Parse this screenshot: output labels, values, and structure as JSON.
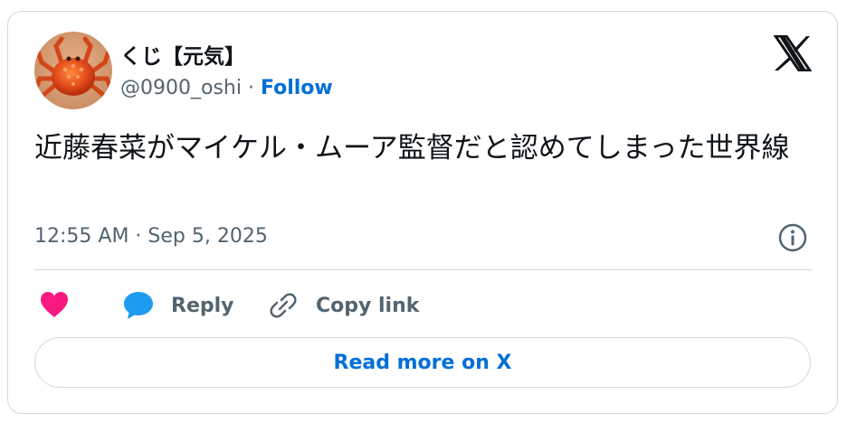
{
  "author": {
    "display_name": "くじ【元気】",
    "handle": "@0900_oshi",
    "separator": " · ",
    "follow_label": "Follow",
    "avatar_icon": "crab-avatar"
  },
  "brand": {
    "logo_icon": "x-logo-icon"
  },
  "tweet": {
    "text": "近藤春菜がマイケル・ムーア監督だと認めてしまった世界線",
    "timestamp": "12:55 AM · Sep 5, 2025"
  },
  "actions": {
    "like_icon": "heart-icon",
    "reply_label": "Reply",
    "reply_icon": "speech-bubble-icon",
    "copy_label": "Copy link",
    "copy_icon": "link-icon",
    "info_icon": "info-icon"
  },
  "footer": {
    "read_more_label": "Read more on X"
  },
  "colors": {
    "follow_blue": "#006fd6",
    "heart_pink": "#f91880",
    "reply_blue": "#1d9bf0",
    "text_primary": "#0f1419",
    "text_secondary": "#536471",
    "border": "#cfd9de"
  }
}
